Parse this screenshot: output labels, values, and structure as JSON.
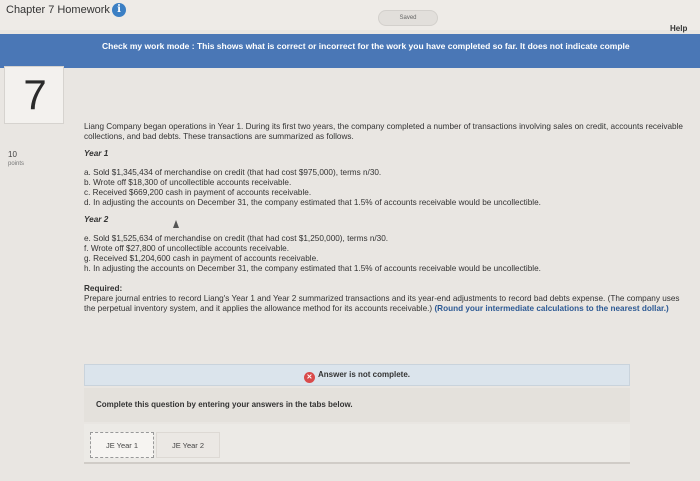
{
  "header": {
    "title": "Chapter 7 Homework",
    "info_icon": "info-circle-icon",
    "saved_label": "Saved",
    "help_label": "Help"
  },
  "banner": {
    "text": "Check my work mode : This shows what is correct or incorrect for the work you have completed so far. It does not indicate comple"
  },
  "question": {
    "number": "7",
    "points_value": "10",
    "points_label": "points",
    "intro": "Liang Company began operations in Year 1. During its first two years, the company completed a number of transactions involving sales on credit, accounts receivable collections, and bad debts. These transactions are summarized as follows.",
    "year1_label": "Year 1",
    "year1_items": [
      "a. Sold $1,345,434 of merchandise on credit (that had cost $975,000), terms n/30.",
      "b. Wrote off $18,300 of uncollectible accounts receivable.",
      "c. Received $669,200 cash in payment of accounts receivable.",
      "d. In adjusting the accounts on December 31, the company estimated that 1.5% of accounts receivable would be uncollectible."
    ],
    "year2_label": "Year 2",
    "year2_items": [
      "e. Sold $1,525,634 of merchandise on credit (that had cost $1,250,000), terms n/30.",
      "f. Wrote off $27,800 of uncollectible accounts receivable.",
      "g. Received $1,204,600 cash in payment of accounts receivable.",
      "h. In adjusting the accounts on December 31, the company estimated that 1.5% of accounts receivable would be uncollectible."
    ],
    "required_label": "Required:",
    "required_text": "Prepare journal entries to record Liang's Year 1 and Year 2 summarized transactions and its year-end adjustments to record bad debts expense. (The company uses the perpetual inventory system, and it applies the allowance method for its accounts receivable.)",
    "round_note": "(Round your intermediate calculations to the nearest dollar.)"
  },
  "answer": {
    "status": "Answer is not complete.",
    "status_icon": "x-circle-icon",
    "status_color": "#d94a4a",
    "instruction": "Complete this question by entering your answers in the tabs below."
  },
  "tabs": [
    {
      "label": "JE Year 1",
      "active": true
    },
    {
      "label": "JE Year 2",
      "active": false
    }
  ],
  "colors": {
    "banner": "#4a77b6",
    "accent": "#3b7fc4"
  }
}
